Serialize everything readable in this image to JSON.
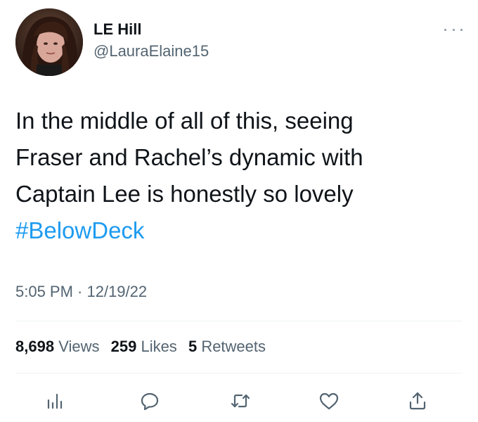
{
  "author": {
    "display_name": "LE Hill",
    "handle": "@LauraElaine15"
  },
  "tweet": {
    "lines": [
      "In the middle of all of this, seeing",
      "Fraser and Rachel’s dynamic with",
      "Captain Lee is honestly so lovely"
    ],
    "hashtag": "#BelowDeck",
    "timestamp": "5:05 PM · 12/19/22"
  },
  "stats": {
    "views_count": "8,698",
    "views_label": "Views",
    "likes_count": "259",
    "likes_label": "Likes",
    "retweets_count": "5",
    "retweets_label": "Retweets"
  },
  "actions": {
    "icons": [
      "analytics-icon",
      "reply-icon",
      "retweet-icon",
      "like-icon",
      "share-icon"
    ]
  },
  "colors": {
    "text": "#0f1419",
    "secondary": "#536471",
    "link": "#1d9bf0",
    "divider": "#eff3f4"
  }
}
